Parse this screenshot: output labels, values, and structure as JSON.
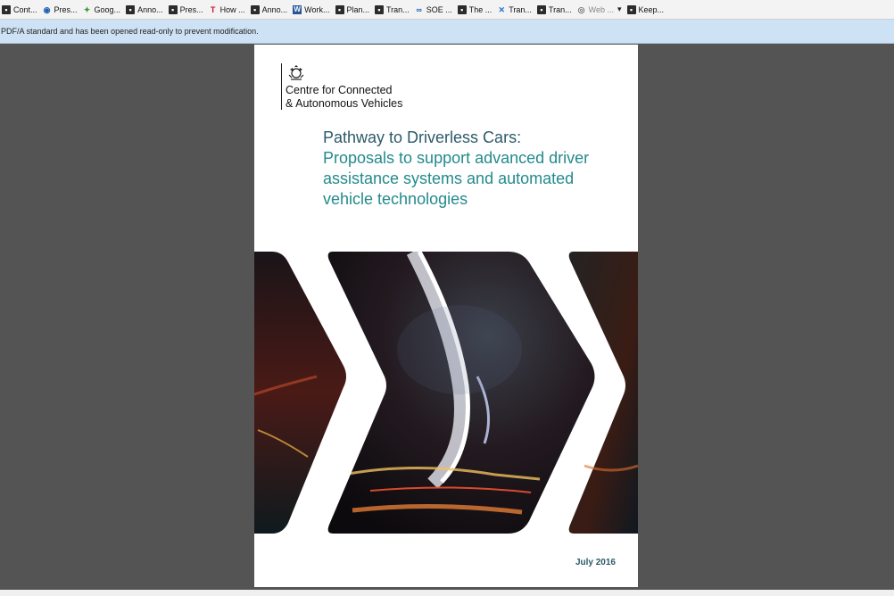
{
  "bookmarks": [
    {
      "label": "Cont...",
      "icon": "page-icon"
    },
    {
      "label": "Pres...",
      "icon": "globe-icon"
    },
    {
      "label": "Goog...",
      "icon": "google-icon"
    },
    {
      "label": "Anno...",
      "icon": "page-icon"
    },
    {
      "label": "Pres...",
      "icon": "page-icon"
    },
    {
      "label": "How ...",
      "icon": "t-icon"
    },
    {
      "label": "Anno...",
      "icon": "page-icon"
    },
    {
      "label": "Work...",
      "icon": "word-icon"
    },
    {
      "label": "Plan...",
      "icon": "page-icon"
    },
    {
      "label": "Tran...",
      "icon": "page-icon"
    },
    {
      "label": "SOE ...",
      "icon": "link-icon"
    },
    {
      "label": "The ...",
      "icon": "page-icon"
    },
    {
      "label": "Tran...",
      "icon": "x-icon"
    },
    {
      "label": "Tran...",
      "icon": "page-icon"
    },
    {
      "label": "Web ...",
      "icon": "web-icon"
    },
    {
      "label": "Keep...",
      "icon": "page-icon"
    }
  ],
  "notification": {
    "text": "PDF/A standard and has been opened read-only to prevent modification."
  },
  "document": {
    "org_line1": "Centre for Connected",
    "org_line2": "& Autonomous Vehicles",
    "title": "Pathway to Driverless Cars:",
    "subtitle_line1": "Proposals to support advanced driver",
    "subtitle_line2": "assistance systems and automated",
    "subtitle_line3": "vehicle technologies",
    "date": "July 2016"
  },
  "colors": {
    "viewer_background": "#545454",
    "title": "#2c5a6a",
    "subtitle": "#238a8c",
    "notification_bar": "#cde2f4"
  }
}
